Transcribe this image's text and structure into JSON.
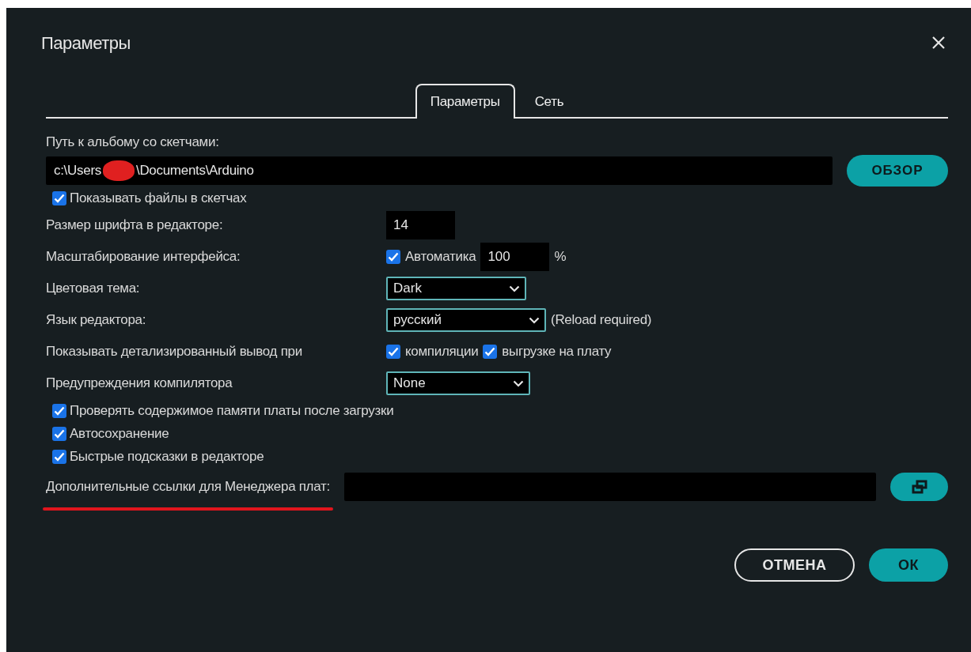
{
  "dialog": {
    "title": "Параметры"
  },
  "tabs": [
    {
      "label": "Параметры",
      "selected": true
    },
    {
      "label": "Сеть",
      "selected": false
    }
  ],
  "sketchbook": {
    "label": "Путь к альбому со скетчами:",
    "path_start": "c:\\Users",
    "path_end": "\\Documents\\Arduino",
    "redacted": true,
    "browse": "ОБЗОР"
  },
  "rows": [
    {
      "kind": "checkbox",
      "label": "Показывать файлы в скетчах",
      "checked": true
    },
    {
      "kind": "input",
      "label": "Размер шрифта в редакторе:",
      "value": "14"
    },
    {
      "kind": "scaling",
      "label": "Масштабирование интерфейса:",
      "auto_label": "Автоматика",
      "checked": true,
      "value": "100",
      "unit": "%"
    },
    {
      "kind": "select",
      "label": "Цветовая тема:",
      "value": "Dark"
    },
    {
      "kind": "select",
      "label": "Язык редактора:",
      "value": "русский",
      "note": "(Reload required)"
    },
    {
      "kind": "verbose",
      "label": "Показывать детализированный вывод при",
      "options": [
        {
          "label": "компиляции",
          "checked": true
        },
        {
          "label": "выгрузке на плату",
          "checked": true
        }
      ]
    },
    {
      "kind": "select",
      "label": "Предупреждения компилятора",
      "value": "None"
    },
    {
      "kind": "checkbox",
      "label": "Проверять содержимое памяти платы после загрузки",
      "checked": true
    },
    {
      "kind": "checkbox",
      "label": "Автосохранение",
      "checked": true
    },
    {
      "kind": "checkbox",
      "label": "Быстрые подсказки в редакторе",
      "checked": true
    },
    {
      "kind": "urls",
      "label": "Дополнительные ссылки для Менеджера плат:",
      "underlined": true
    }
  ],
  "buttons": [
    {
      "label": "ОТМЕНА",
      "kind": "outline"
    },
    {
      "label": "ОК",
      "kind": "primary"
    }
  ]
}
